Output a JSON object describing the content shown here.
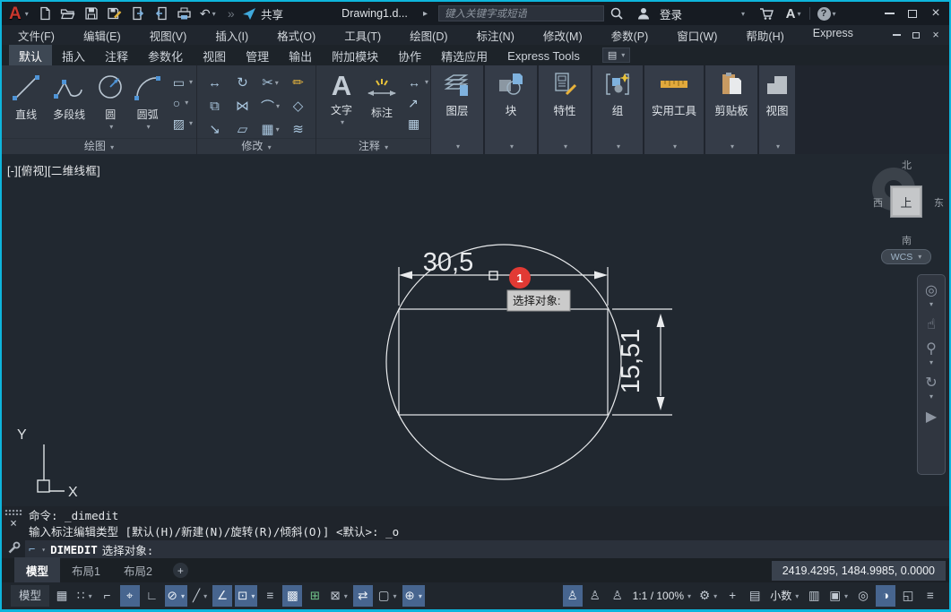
{
  "window": {
    "doc_title": "Drawing1.d...",
    "border_color": "#0db5dc"
  },
  "icons": {
    "dropdown": "▾",
    "play": "▸",
    "undo": "↶",
    "redo": "»",
    "cmd_dim": "⌐",
    "plus": "+",
    "close": "×",
    "ribbon_display": "▤"
  },
  "titlebar": {
    "logo": "A",
    "share_label": "共享",
    "search_placeholder": "键入关键字或短语",
    "signin_label": "登录",
    "autodesk_logo": "A",
    "help": "?",
    "quick_access_icons": [
      "app-menu",
      "new-file",
      "open-file",
      "save",
      "save-as",
      "open-from-web-mobile",
      "save-to-web-mobile",
      "plot",
      "undo",
      "redo",
      "share"
    ]
  },
  "menubar": {
    "items": [
      {
        "label": "文件(F)",
        "name": "menu-file"
      },
      {
        "label": "编辑(E)",
        "name": "menu-edit"
      },
      {
        "label": "视图(V)",
        "name": "menu-view"
      },
      {
        "label": "插入(I)",
        "name": "menu-insert"
      },
      {
        "label": "格式(O)",
        "name": "menu-format"
      },
      {
        "label": "工具(T)",
        "name": "menu-tools"
      },
      {
        "label": "绘图(D)",
        "name": "menu-draw"
      },
      {
        "label": "标注(N)",
        "name": "menu-dimension"
      },
      {
        "label": "修改(M)",
        "name": "menu-modify"
      },
      {
        "label": "参数(P)",
        "name": "menu-parametric"
      },
      {
        "label": "窗口(W)",
        "name": "menu-window"
      },
      {
        "label": "帮助(H)",
        "name": "menu-help"
      },
      {
        "label": "Express",
        "name": "menu-express"
      }
    ]
  },
  "ribbon": {
    "tabs": [
      {
        "label": "默认",
        "name": "tab-home",
        "active": true
      },
      {
        "label": "插入",
        "name": "tab-insert"
      },
      {
        "label": "注释",
        "name": "tab-annotate"
      },
      {
        "label": "参数化",
        "name": "tab-parametric"
      },
      {
        "label": "视图",
        "name": "tab-view"
      },
      {
        "label": "管理",
        "name": "tab-manage"
      },
      {
        "label": "输出",
        "name": "tab-output"
      },
      {
        "label": "附加模块",
        "name": "tab-add-ins"
      },
      {
        "label": "协作",
        "name": "tab-collaborate"
      },
      {
        "label": "精选应用",
        "name": "tab-featured-apps"
      },
      {
        "label": "Express Tools",
        "name": "tab-express-tools"
      }
    ],
    "draw": {
      "label": "绘图",
      "big": [
        {
          "label": "直线",
          "name": "line-button"
        },
        {
          "label": "多段线",
          "name": "polyline-button"
        },
        {
          "label": "圆",
          "name": "circle-button"
        },
        {
          "label": "圆弧",
          "name": "arc-button"
        }
      ],
      "small": [
        {
          "glyph": "▭",
          "name": "rectangle-button",
          "dropdown": true
        },
        {
          "glyph": "○",
          "name": "ellipse-button",
          "dropdown": true
        },
        {
          "glyph": "▨",
          "name": "hatch-button",
          "dropdown": true
        }
      ]
    },
    "modify": {
      "label": "修改",
      "items": [
        {
          "glyph": "↔",
          "name": "move-button"
        },
        {
          "glyph": "↻",
          "name": "rotate-button"
        },
        {
          "glyph": "✂",
          "name": "trim-button",
          "dropdown": true
        },
        {
          "glyph": "✏",
          "name": "erase-button",
          "cls": "yellow"
        },
        {
          "glyph": "⧉",
          "name": "copy-button"
        },
        {
          "glyph": "⋈",
          "name": "mirror-button"
        },
        {
          "glyph": "⌒",
          "name": "fillet-button",
          "dropdown": true
        },
        {
          "glyph": "◇",
          "name": "explode-button"
        },
        {
          "glyph": "↘",
          "name": "stretch-button"
        },
        {
          "glyph": "▱",
          "name": "scale-button"
        },
        {
          "glyph": "▦",
          "name": "array-button",
          "dropdown": true
        },
        {
          "glyph": "≋",
          "name": "offset-button"
        }
      ]
    },
    "annotate": {
      "label": "注释",
      "text_glyph": "A",
      "text_label": "文字",
      "dim_label": "标注",
      "small": [
        {
          "glyph": "↔",
          "name": "linear-dimension-button",
          "dropdown": true
        },
        {
          "glyph": "↗",
          "name": "leader-button"
        },
        {
          "glyph": "▦",
          "name": "table-button"
        }
      ]
    },
    "tall_panels": [
      {
        "label": "图层",
        "name": "layers-panel-button"
      },
      {
        "label": "块",
        "name": "block-panel-button"
      },
      {
        "label": "特性",
        "name": "properties-panel-button"
      },
      {
        "label": "组",
        "name": "groups-panel-button"
      },
      {
        "label": "实用工具",
        "name": "utilities-panel-button"
      },
      {
        "label": "剪贴板",
        "name": "clipboard-panel-button"
      },
      {
        "label": "视图",
        "name": "view-panel-button"
      }
    ]
  },
  "viewport": {
    "label": "[-][俯视][二维线框]",
    "viewcube": {
      "north": "北",
      "south": "南",
      "west": "西",
      "east": "东",
      "face": "上",
      "wcs": "WCS"
    },
    "navbar": [
      {
        "glyph": "◎",
        "name": "steering-wheel-button",
        "dropdown": true
      },
      {
        "glyph": "☝",
        "name": "pan-button"
      },
      {
        "glyph": "⚲",
        "name": "zoom-button",
        "dropdown": true
      },
      {
        "glyph": "↻",
        "name": "orbit-button",
        "dropdown": true
      },
      {
        "glyph": "▶",
        "name": "show-motion-button"
      }
    ]
  },
  "drawing": {
    "dim_horizontal": "30,5",
    "dim_vertical": "15,51",
    "badge": "1",
    "tooltip": "选择对象:",
    "ucs_x": "X",
    "ucs_y": "Y",
    "badge_color": "#e23a34"
  },
  "command": {
    "history": [
      "命令: _dimedit",
      "输入标注编辑类型 [默认(H)/新建(N)/旋转(R)/倾斜(O)] <默认>: _o"
    ],
    "active_command": "DIMEDIT",
    "active_prompt": "选择对象:"
  },
  "layout_bar": {
    "tabs": [
      {
        "label": "模型",
        "name": "model-tab",
        "active": true
      },
      {
        "label": "布局1",
        "name": "layout1-tab"
      },
      {
        "label": "布局2",
        "name": "layout2-tab"
      }
    ],
    "add": "+",
    "coordinates": "2419.4295, 1484.9985, 0.0000"
  },
  "statusbar": {
    "active_color": "#47658f",
    "left": [
      {
        "label": "模型",
        "name": "model-space-toggle",
        "cls": "model"
      },
      {
        "glyph": "▦",
        "name": "grid-display-toggle"
      },
      {
        "glyph": "∷",
        "name": "snap-mode-toggle",
        "dropdown": true
      },
      {
        "glyph": "⌐",
        "name": "infer-constraints-toggle"
      },
      {
        "glyph": "⌖",
        "name": "dynamic-input-toggle",
        "active": true
      },
      {
        "glyph": "∟",
        "name": "ortho-mode-toggle"
      },
      {
        "glyph": "⊘",
        "name": "polar-tracking-toggle",
        "active": true,
        "dropdown": true
      },
      {
        "glyph": "╱",
        "name": "isometric-drafting-toggle",
        "dropdown": true
      },
      {
        "glyph": "∠",
        "name": "object-snap-tracking-toggle",
        "active": true
      },
      {
        "glyph": "⊡",
        "name": "object-snap-toggle",
        "active": true,
        "dropdown": true
      },
      {
        "glyph": "≡",
        "name": "lineweight-toggle"
      },
      {
        "glyph": "▩",
        "name": "transparency-toggle",
        "active": true
      },
      {
        "glyph": "⊞",
        "name": "selection-cycling-toggle",
        "cls": "green"
      },
      {
        "glyph": "⊠",
        "name": "3d-object-snap-toggle",
        "dropdown": true
      },
      {
        "glyph": "⇄",
        "name": "dynamic-ucs-toggle",
        "active": true
      },
      {
        "glyph": "▢",
        "name": "selection-filtering-toggle",
        "dropdown": true
      },
      {
        "glyph": "⊕",
        "name": "gizmo-toggle",
        "active": true,
        "dropdown": true
      }
    ],
    "right": [
      {
        "glyph": "♙",
        "name": "annotation-visibility-toggle",
        "active": true
      },
      {
        "glyph": "♙",
        "name": "auto-annotation-scale-toggle"
      },
      {
        "glyph": "♙",
        "name": "annotation-scale-button"
      },
      {
        "label": "1:1 / 100%",
        "name": "annotation-scale-value",
        "cls": "textval",
        "dropdown": true
      },
      {
        "glyph": "⚙",
        "name": "workspace-switching-button",
        "dropdown": true
      },
      {
        "glyph": "+",
        "name": "statusbar-plus-button"
      },
      {
        "glyph": "▤",
        "name": "units-icon-button"
      },
      {
        "label": "小数",
        "name": "units-value",
        "cls": "textval",
        "dropdown": true
      },
      {
        "glyph": "▥",
        "name": "properties-palette-button"
      },
      {
        "glyph": "▣",
        "name": "lock-ui-button",
        "dropdown": true
      },
      {
        "glyph": "◎",
        "name": "isolate-objects-button"
      },
      {
        "glyph": "◑",
        "name": "graphics-performance-toggle",
        "active": true
      },
      {
        "glyph": "◱",
        "name": "clean-screen-button"
      },
      {
        "glyph": "≡",
        "name": "customize-statusbar-button"
      }
    ]
  }
}
